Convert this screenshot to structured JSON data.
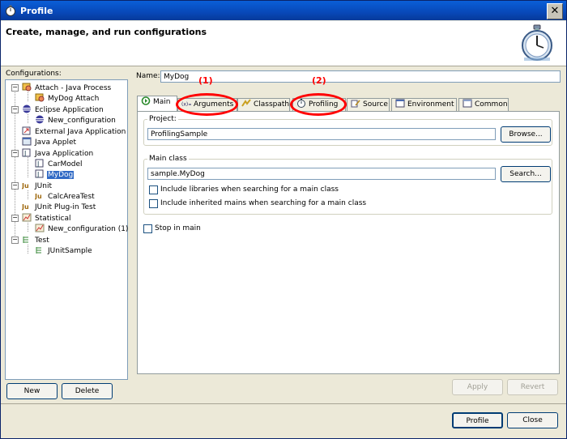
{
  "window": {
    "title": "Profile",
    "close_glyph": "✕"
  },
  "header": {
    "text": "Create, manage, and run configurations",
    "icon": "stopwatch-icon"
  },
  "configurations_label": "Configurations:",
  "tree": [
    {
      "label": "Attach - Java Process",
      "icon": "attach-icon",
      "expanded": true
    },
    {
      "label": "MyDog Attach",
      "icon": "attach-config-icon"
    },
    {
      "label": "Eclipse Application",
      "icon": "eclipse-icon",
      "expanded": true
    },
    {
      "label": "New_configuration",
      "icon": "eclipse-config-icon"
    },
    {
      "label": "External Java Application",
      "icon": "external-java-icon"
    },
    {
      "label": "Java Applet",
      "icon": "applet-icon"
    },
    {
      "label": "Java Application",
      "icon": "java-app-icon",
      "expanded": true
    },
    {
      "label": "CarModel",
      "icon": "java-config-icon"
    },
    {
      "label": "MyDog",
      "icon": "java-config-icon",
      "selected": true
    },
    {
      "label": "JUnit",
      "icon": "junit-icon",
      "expanded": true
    },
    {
      "label": "CalcAreaTest",
      "icon": "junit-config-icon"
    },
    {
      "label": "JUnit Plug-in Test",
      "icon": "junit-plugin-icon"
    },
    {
      "label": "Statistical",
      "icon": "statistical-icon",
      "expanded": true
    },
    {
      "label": "New_configuration (1)",
      "icon": "statistical-config-icon"
    },
    {
      "label": "Test",
      "icon": "test-icon",
      "expanded": true
    },
    {
      "label": "JUnitSample",
      "icon": "test-config-icon"
    }
  ],
  "buttons": {
    "new": "New",
    "delete": "Delete",
    "apply": "Apply",
    "revert": "Revert",
    "profile": "Profile",
    "close": "Close",
    "browse": "Browse...",
    "search": "Search..."
  },
  "name_label": "Name:",
  "name_value": "MyDog",
  "tabs": [
    {
      "label": "Main",
      "icon": "main-tab-icon",
      "active": true
    },
    {
      "label": "Arguments",
      "icon": "arguments-tab-icon"
    },
    {
      "label": "Classpath",
      "icon": "classpath-tab-icon"
    },
    {
      "label": "Profiling",
      "icon": "profiling-tab-icon"
    },
    {
      "label": "Source",
      "icon": "source-tab-icon"
    },
    {
      "label": "Environment",
      "icon": "environment-tab-icon"
    },
    {
      "label": "Common",
      "icon": "common-tab-icon"
    }
  ],
  "project": {
    "label": "Project:",
    "value": "ProfilingSample"
  },
  "main_class": {
    "label": "Main class",
    "value": "sample.MyDog"
  },
  "checkboxes": {
    "include_libraries": {
      "label": "Include libraries when searching for a main class",
      "checked": false
    },
    "include_inherited": {
      "label": "Include inherited mains when searching for a main class",
      "checked": false
    },
    "stop_in_main": {
      "label": "Stop in main",
      "checked": false
    }
  },
  "annotations": {
    "first": "(1)",
    "second": "(2)",
    "color": "#ff0000"
  },
  "colors": {
    "titlebar": "#0a5fd8",
    "selection": "#316ac5"
  }
}
